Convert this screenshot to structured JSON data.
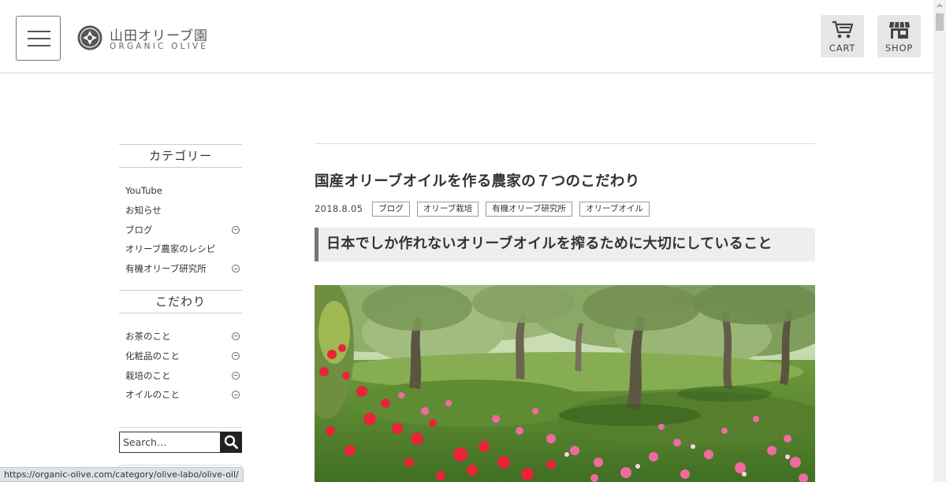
{
  "header": {
    "logo_jp": "山田オリーブ園",
    "logo_en": "ORGANIC OLIVE",
    "cart_label": "CART",
    "shop_label": "SHOP"
  },
  "sidebar": {
    "category_heading": "カテゴリー",
    "categories": [
      {
        "label": "YouTube",
        "expandable": false
      },
      {
        "label": "お知らせ",
        "expandable": false
      },
      {
        "label": "ブログ",
        "expandable": true
      },
      {
        "label": "オリーブ農家のレシピ",
        "expandable": false
      },
      {
        "label": "有機オリーブ研究所",
        "expandable": true
      }
    ],
    "kodawari_heading": "こだわり",
    "kodawari": [
      {
        "label": "お茶のこと",
        "expandable": true
      },
      {
        "label": "化粧品のこと",
        "expandable": true
      },
      {
        "label": "栽培のこと",
        "expandable": true
      },
      {
        "label": "オイルのこと",
        "expandable": true
      }
    ],
    "search_placeholder": "Search…"
  },
  "post": {
    "title": "国産オリーブオイルを作る農家の７つのこだわり",
    "date": "2018.8.05",
    "tags": [
      "ブログ",
      "オリーブ栽培",
      "有機オリーブ研究所",
      "オリーブオイル"
    ],
    "subheading": "日本でしか作れないオリーブオイルを搾るために大切にしていること"
  },
  "status_bar": {
    "url": "https://organic-olive.com/category/olive-labo/olive-oil/"
  }
}
